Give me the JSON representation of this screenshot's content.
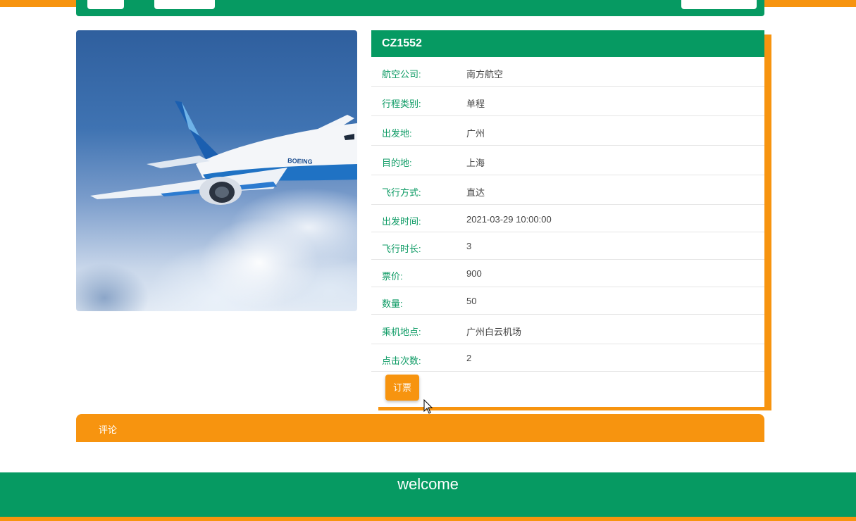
{
  "flight": {
    "code": "CZ1552",
    "details": [
      {
        "label": "航空公司:",
        "value": "南方航空"
      },
      {
        "label": "行程类别:",
        "value": "单程"
      },
      {
        "label": "出发地:",
        "value": "广州"
      },
      {
        "label": "目的地:",
        "value": "上海"
      },
      {
        "label": "飞行方式:",
        "value": "直达"
      },
      {
        "label": "出发时间:",
        "value": "2021-03-29 10:00:00"
      },
      {
        "label": "飞行时长:",
        "value": "3"
      },
      {
        "label": "票价:",
        "value": "900"
      },
      {
        "label": "数量:",
        "value": "50"
      },
      {
        "label": "乘机地点:",
        "value": "广州白云机场"
      },
      {
        "label": "点击次数:",
        "value": "2"
      }
    ],
    "book_label": "订票"
  },
  "photo": {
    "brand_text": "BOEING"
  },
  "comments": {
    "label": "评论"
  },
  "footer": {
    "text": "welcome"
  },
  "colors": {
    "green": "#069a62",
    "orange": "#f7940f",
    "label_green": "#0b9a63"
  }
}
